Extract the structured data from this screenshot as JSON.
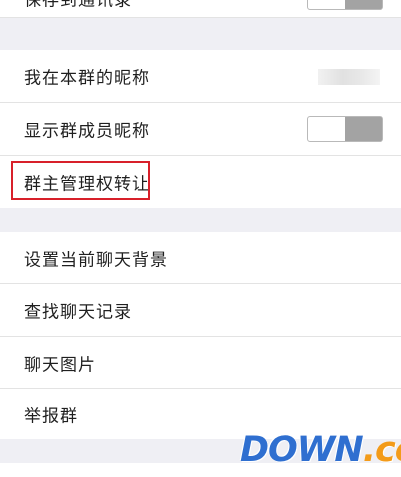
{
  "settings": {
    "save_to_contacts_label": "保存到通讯录",
    "my_group_nickname_label": "我在本群的昵称",
    "show_member_nicknames_label": "显示群成员昵称",
    "transfer_owner_label": "群主管理权转让",
    "set_chat_background_label": "设置当前聊天背景",
    "search_chat_history_label": "查找聊天记录",
    "chat_images_label": "聊天图片",
    "report_group_label": "举报群"
  },
  "toggles": {
    "save_to_contacts": "off",
    "show_member_nicknames": "off"
  },
  "watermark": {
    "main": "DOWN",
    "dot": ".",
    "tld": "cc"
  },
  "colors": {
    "highlight_border": "#d8202a",
    "watermark_blue": "#2f6fd0",
    "watermark_orange": "#f39b1a",
    "page_background": "#efeff4"
  }
}
